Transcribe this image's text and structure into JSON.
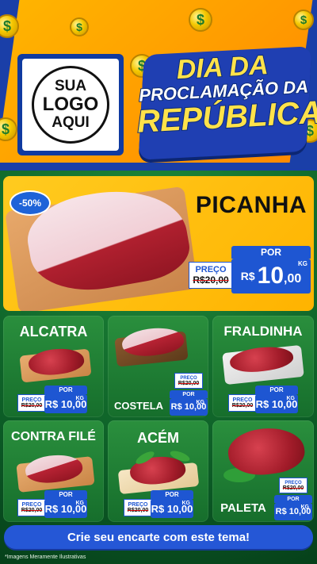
{
  "header": {
    "logo_lines": [
      "SUA",
      "LOGO",
      "AQUI"
    ],
    "title_lines": [
      "DIA DA",
      "PROCLAMAÇÃO DA",
      "REPÚBLICA"
    ],
    "coin_symbol": "$"
  },
  "featured": {
    "discount_badge": "-50%",
    "name": "PICANHA",
    "price_label": "PREÇO",
    "old_price": "R$20,00",
    "por_label": "POR",
    "price_currency": "R$",
    "price_int": "10",
    "price_cents": ",00",
    "unit": "KG"
  },
  "products": [
    {
      "name": "ALCATRA",
      "price_label": "PREÇO",
      "old_price": "R$20,00",
      "por_label": "POR",
      "price": "R$ 10,00",
      "unit": "KG"
    },
    {
      "name": "COSTELA",
      "price_label": "PREÇO",
      "old_price": "R$20,00",
      "por_label": "POR",
      "price": "R$ 10,00",
      "unit": "KG"
    },
    {
      "name": "FRALDINHA",
      "price_label": "PREÇO",
      "old_price": "R$20,00",
      "por_label": "POR",
      "price": "R$ 10,00",
      "unit": "KG"
    },
    {
      "name": "CONTRA FILÉ",
      "price_label": "PREÇO",
      "old_price": "R$20,00",
      "por_label": "POR",
      "price": "R$ 10,00",
      "unit": "KG"
    },
    {
      "name": "ACÉM",
      "price_label": "PREÇO",
      "old_price": "R$20,00",
      "por_label": "POR",
      "price": "R$ 10,00",
      "unit": "KG"
    },
    {
      "name": "PALETA",
      "price_label": "PREÇO",
      "old_price": "R$20,00",
      "por_label": "POR",
      "price": "R$ 10,00",
      "unit": "KG"
    }
  ],
  "cta": {
    "label": "Crie seu encarte com este tema!"
  },
  "footnote": "*Imagens Meramente Ilustrativas",
  "colors": {
    "accent_blue": "#1e56d2",
    "header_orange": "#ffa800",
    "background_green": "#1f8a3a",
    "title_yellow": "#ffe24a"
  }
}
